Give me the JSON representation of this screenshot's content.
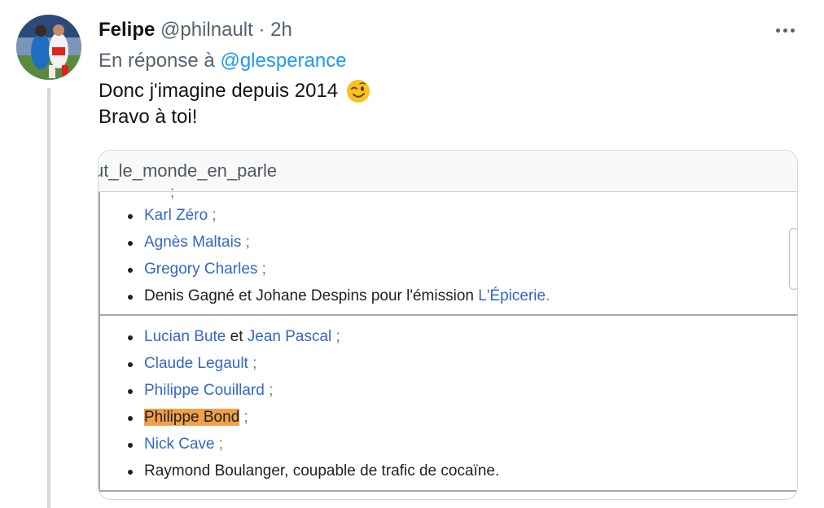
{
  "tweet": {
    "author_name": "Felipe",
    "author_handle": "@philnault",
    "separator": "·",
    "time": "2h",
    "reply_prefix": "En réponse à",
    "reply_to": "@glesperance",
    "text_line1": "Donc j'imagine depuis 2014",
    "text_line2": "Bravo à toi!",
    "emoji": "winking-face-emoji"
  },
  "media": {
    "page_title": "ut_le_monde_en_parle",
    "partial_top": ";",
    "list1": [
      {
        "link": "Karl Zéro",
        "suffix": " ;"
      },
      {
        "link": "Agnès Maltais",
        "suffix": " ;"
      },
      {
        "link": "Gregory Charles",
        "suffix": " ;"
      },
      {
        "plain": "Denis Gagné et Johane Despins pour l'émission ",
        "link": "L'Épicerie",
        "suffix": "."
      }
    ],
    "list2": [
      {
        "link": "Lucian Bute",
        "mid": " et ",
        "link2": "Jean Pascal",
        "suffix": " ;"
      },
      {
        "link": "Claude Legault",
        "suffix": " ;"
      },
      {
        "link": "Philippe Couillard",
        "suffix": " ;"
      },
      {
        "highlight": "Philippe Bond",
        "suffix": " ;"
      },
      {
        "link": "Nick Cave",
        "suffix": " ;"
      },
      {
        "plain": "Raymond Boulanger, coupable de trafic de cocaïne."
      }
    ]
  },
  "colors": {
    "link": "#3366cc",
    "mention": "#1d9bf0",
    "highlight": "#f0a049"
  }
}
